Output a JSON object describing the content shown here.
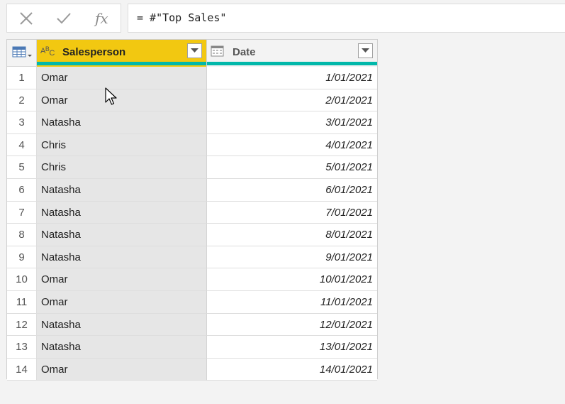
{
  "formula_bar": {
    "cancel_icon": "close-icon",
    "commit_icon": "check-icon",
    "fx_label": "fx",
    "formula": "= #\"Top Sales\""
  },
  "columns": [
    {
      "name": "Salesperson",
      "type_icon": "text-type-icon",
      "type_label": "ABC",
      "accent": "#f2c811"
    },
    {
      "name": "Date",
      "type_icon": "calendar-icon"
    }
  ],
  "quality_bar_color": "#01b8aa",
  "rows": [
    {
      "num": "1",
      "salesperson": "Omar",
      "date": "1/01/2021"
    },
    {
      "num": "2",
      "salesperson": "Omar",
      "date": "2/01/2021"
    },
    {
      "num": "3",
      "salesperson": "Natasha",
      "date": "3/01/2021"
    },
    {
      "num": "4",
      "salesperson": "Chris",
      "date": "4/01/2021"
    },
    {
      "num": "5",
      "salesperson": "Chris",
      "date": "5/01/2021"
    },
    {
      "num": "6",
      "salesperson": "Natasha",
      "date": "6/01/2021"
    },
    {
      "num": "7",
      "salesperson": "Natasha",
      "date": "7/01/2021"
    },
    {
      "num": "8",
      "salesperson": "Natasha",
      "date": "8/01/2021"
    },
    {
      "num": "9",
      "salesperson": "Natasha",
      "date": "9/01/2021"
    },
    {
      "num": "10",
      "salesperson": "Omar",
      "date": "10/01/2021"
    },
    {
      "num": "11",
      "salesperson": "Omar",
      "date": "11/01/2021"
    },
    {
      "num": "12",
      "salesperson": "Natasha",
      "date": "12/01/2021"
    },
    {
      "num": "13",
      "salesperson": "Natasha",
      "date": "13/01/2021"
    },
    {
      "num": "14",
      "salesperson": "Omar",
      "date": "14/01/2021"
    }
  ]
}
